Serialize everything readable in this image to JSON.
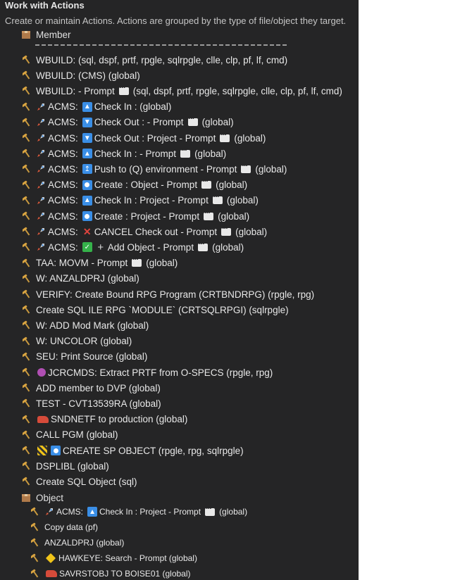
{
  "panel": {
    "title": "Work with Actions",
    "subtitle": "Create or maintain Actions. Actions are grouped by the type of file/object they target."
  },
  "groups": {
    "member": "Member",
    "object": "Object"
  },
  "member_actions": [
    {
      "parts": [
        {
          "t": "text",
          "v": "WBUILD: (sql, dspf, prtf, rpgle, sqlrpgle, clle, clp, pf, lf, cmd)"
        }
      ]
    },
    {
      "parts": [
        {
          "t": "text",
          "v": "WBUILD: (CMS) (global)"
        }
      ]
    },
    {
      "parts": [
        {
          "t": "text",
          "v": "WBUILD: - Prompt"
        },
        {
          "t": "speech"
        },
        {
          "t": "text",
          "v": "(sql, dspf, prtf, rpgle, sqlrpgle, clle, clp, pf, lf, cmd)"
        }
      ]
    },
    {
      "parts": [
        {
          "t": "rocket"
        },
        {
          "t": "text",
          "v": "ACMS:"
        },
        {
          "t": "icon",
          "c": "blue",
          "g": "▲"
        },
        {
          "t": "text",
          "v": "Check In : (global)"
        }
      ]
    },
    {
      "parts": [
        {
          "t": "rocket"
        },
        {
          "t": "text",
          "v": "ACMS:"
        },
        {
          "t": "icon",
          "c": "blue",
          "g": "▼"
        },
        {
          "t": "text",
          "v": "Check Out : - Prompt"
        },
        {
          "t": "speech"
        },
        {
          "t": "text",
          "v": "(global)"
        }
      ]
    },
    {
      "parts": [
        {
          "t": "rocket"
        },
        {
          "t": "text",
          "v": "ACMS:"
        },
        {
          "t": "icon",
          "c": "blue",
          "g": "▼"
        },
        {
          "t": "text",
          "v": "Check Out : Project - Prompt"
        },
        {
          "t": "speech"
        },
        {
          "t": "text",
          "v": "(global)"
        }
      ]
    },
    {
      "parts": [
        {
          "t": "rocket"
        },
        {
          "t": "text",
          "v": "ACMS:"
        },
        {
          "t": "icon",
          "c": "blue",
          "g": "▲"
        },
        {
          "t": "text",
          "v": "Check In : - Prompt"
        },
        {
          "t": "speech"
        },
        {
          "t": "text",
          "v": "(global)"
        }
      ]
    },
    {
      "parts": [
        {
          "t": "rocket"
        },
        {
          "t": "text",
          "v": "ACMS:"
        },
        {
          "t": "icon",
          "c": "blue",
          "g": "↥"
        },
        {
          "t": "text",
          "v": "Push to (Q) environment - Prompt"
        },
        {
          "t": "speech"
        },
        {
          "t": "text",
          "v": "(global)"
        }
      ]
    },
    {
      "parts": [
        {
          "t": "rocket"
        },
        {
          "t": "text",
          "v": "ACMS:"
        },
        {
          "t": "icon",
          "c": "blue-circle",
          "g": ""
        },
        {
          "t": "text",
          "v": "Create : Object - Prompt"
        },
        {
          "t": "speech"
        },
        {
          "t": "text",
          "v": "(global)"
        }
      ]
    },
    {
      "parts": [
        {
          "t": "rocket"
        },
        {
          "t": "text",
          "v": "ACMS:"
        },
        {
          "t": "icon",
          "c": "blue",
          "g": "▲"
        },
        {
          "t": "text",
          "v": "Check In : Project - Prompt"
        },
        {
          "t": "speech"
        },
        {
          "t": "text",
          "v": "(global)"
        }
      ]
    },
    {
      "parts": [
        {
          "t": "rocket"
        },
        {
          "t": "text",
          "v": "ACMS:"
        },
        {
          "t": "icon",
          "c": "blue-circle",
          "g": ""
        },
        {
          "t": "text",
          "v": "Create : Project - Prompt"
        },
        {
          "t": "speech"
        },
        {
          "t": "text",
          "v": "(global)"
        }
      ]
    },
    {
      "parts": [
        {
          "t": "rocket"
        },
        {
          "t": "text",
          "v": "ACMS:"
        },
        {
          "t": "icon",
          "c": "red",
          "g": "✕"
        },
        {
          "t": "text",
          "v": "CANCEL Check out - Prompt"
        },
        {
          "t": "speech"
        },
        {
          "t": "text",
          "v": "(global)"
        }
      ]
    },
    {
      "parts": [
        {
          "t": "rocket"
        },
        {
          "t": "text",
          "v": "ACMS:"
        },
        {
          "t": "icon",
          "c": "green",
          "g": "✓"
        },
        {
          "t": "icon",
          "c": "plus",
          "g": "+"
        },
        {
          "t": "text",
          "v": "Add Object - Prompt"
        },
        {
          "t": "speech"
        },
        {
          "t": "text",
          "v": "(global)"
        }
      ]
    },
    {
      "parts": [
        {
          "t": "text",
          "v": "TAA: MOVM - Prompt"
        },
        {
          "t": "speech"
        },
        {
          "t": "text",
          "v": "(global)"
        }
      ]
    },
    {
      "parts": [
        {
          "t": "text",
          "v": "W: ANZALDPRJ (global)"
        }
      ]
    },
    {
      "parts": [
        {
          "t": "text",
          "v": "VERIFY: Create Bound RPG Program (CRTBNDRPG) (rpgle, rpg)"
        }
      ]
    },
    {
      "parts": [
        {
          "t": "text",
          "v": "Create SQL ILE RPG `MODULE` (CRTSQLRPGI) (sqlrpgle)"
        }
      ]
    },
    {
      "parts": [
        {
          "t": "text",
          "v": "W: ADD Mod Mark (global)"
        }
      ]
    },
    {
      "parts": [
        {
          "t": "text",
          "v": "W: UNCOLOR (global)"
        }
      ]
    },
    {
      "parts": [
        {
          "t": "text",
          "v": "SEU: Print Source (global)"
        }
      ]
    },
    {
      "parts": [
        {
          "t": "icon",
          "c": "pink",
          "g": ""
        },
        {
          "t": "text",
          "v": "JCRCMDS: Extract PRTF from O-SPECS (rpgle, rpg)"
        }
      ]
    },
    {
      "parts": [
        {
          "t": "text",
          "v": "ADD member to DVP (global)"
        }
      ]
    },
    {
      "parts": [
        {
          "t": "text",
          "v": "TEST - CVT13539RA (global)"
        }
      ]
    },
    {
      "parts": [
        {
          "t": "icon",
          "c": "truck",
          "g": ""
        },
        {
          "t": "text",
          "v": "SNDNETF to production (global)"
        }
      ]
    },
    {
      "parts": [
        {
          "t": "text",
          "v": "CALL PGM (global)"
        }
      ]
    },
    {
      "parts": [
        {
          "t": "icon",
          "c": "stripe",
          "g": ""
        },
        {
          "t": "icon",
          "c": "blue-circle",
          "g": ""
        },
        {
          "t": "text",
          "v": "CREATE SP OBJECT (rpgle, rpg, sqlrpgle)"
        }
      ]
    },
    {
      "parts": [
        {
          "t": "text",
          "v": "DSPLIBL (global)"
        }
      ]
    },
    {
      "parts": [
        {
          "t": "text",
          "v": "Create SQL Object (sql)"
        }
      ]
    }
  ],
  "object_actions": [
    {
      "parts": [
        {
          "t": "rocket"
        },
        {
          "t": "text",
          "v": "ACMS:"
        },
        {
          "t": "icon",
          "c": "blue",
          "g": "▲"
        },
        {
          "t": "text",
          "v": "Check In : Project - Prompt"
        },
        {
          "t": "speech"
        },
        {
          "t": "text",
          "v": "(global)"
        }
      ]
    },
    {
      "parts": [
        {
          "t": "text",
          "v": "Copy data (pf)"
        }
      ]
    },
    {
      "parts": [
        {
          "t": "text",
          "v": "ANZALDPRJ (global)"
        }
      ]
    },
    {
      "parts": [
        {
          "t": "icon",
          "c": "yellow",
          "g": ""
        },
        {
          "t": "text",
          "v": "HAWKEYE: Search - Prompt (global)"
        }
      ]
    },
    {
      "parts": [
        {
          "t": "icon",
          "c": "truck",
          "g": ""
        },
        {
          "t": "text",
          "v": "SAVRSTOBJ TO BOISE01 (global)"
        }
      ]
    }
  ],
  "colors": {
    "panel_bg": "#252526",
    "text": "#e8e8e8",
    "accent_blue": "#3a8ee6"
  },
  "icons": {
    "action": "hammer-icon",
    "group": "box-icon",
    "rocket": "rocket-icon",
    "prompt": "speech-bubble-icon"
  }
}
